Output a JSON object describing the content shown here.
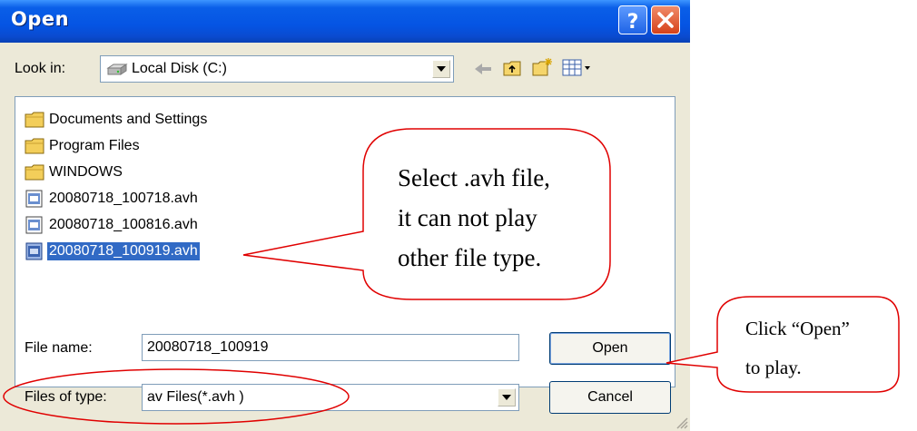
{
  "window": {
    "title": "Open"
  },
  "toolbar": {
    "look_in_label": "Look in:",
    "location": "Local Disk (C:)"
  },
  "files": [
    {
      "name": "Documents and Settings",
      "type": "folder",
      "selected": false
    },
    {
      "name": "Program Files",
      "type": "folder",
      "selected": false
    },
    {
      "name": "WINDOWS",
      "type": "folder",
      "selected": false
    },
    {
      "name": "20080718_100718.avh",
      "type": "file",
      "selected": false
    },
    {
      "name": "20080718_100816.avh",
      "type": "file",
      "selected": false
    },
    {
      "name": "20080718_100919.avh",
      "type": "file",
      "selected": true
    }
  ],
  "form": {
    "file_name_label": "File name:",
    "file_name_value": "20080718_100919",
    "file_type_label": "Files of type:",
    "file_type_value": "av Files(*.avh )",
    "open_button": "Open",
    "cancel_button": "Cancel"
  },
  "callouts": {
    "select_line1": "Select .avh file,",
    "select_line2": "it can not play",
    "select_line3": "other file type.",
    "open_line1": "Click  “Open”",
    "open_line2": "to play."
  },
  "colors": {
    "title_bar": "#0554e3",
    "dialog_bg": "#ECE9D8",
    "selection": "#316ac5",
    "annotation": "#e00000"
  },
  "icons": {
    "drive": "hard-drive-icon",
    "folder": "folder-icon",
    "file": "avh-file-icon"
  }
}
